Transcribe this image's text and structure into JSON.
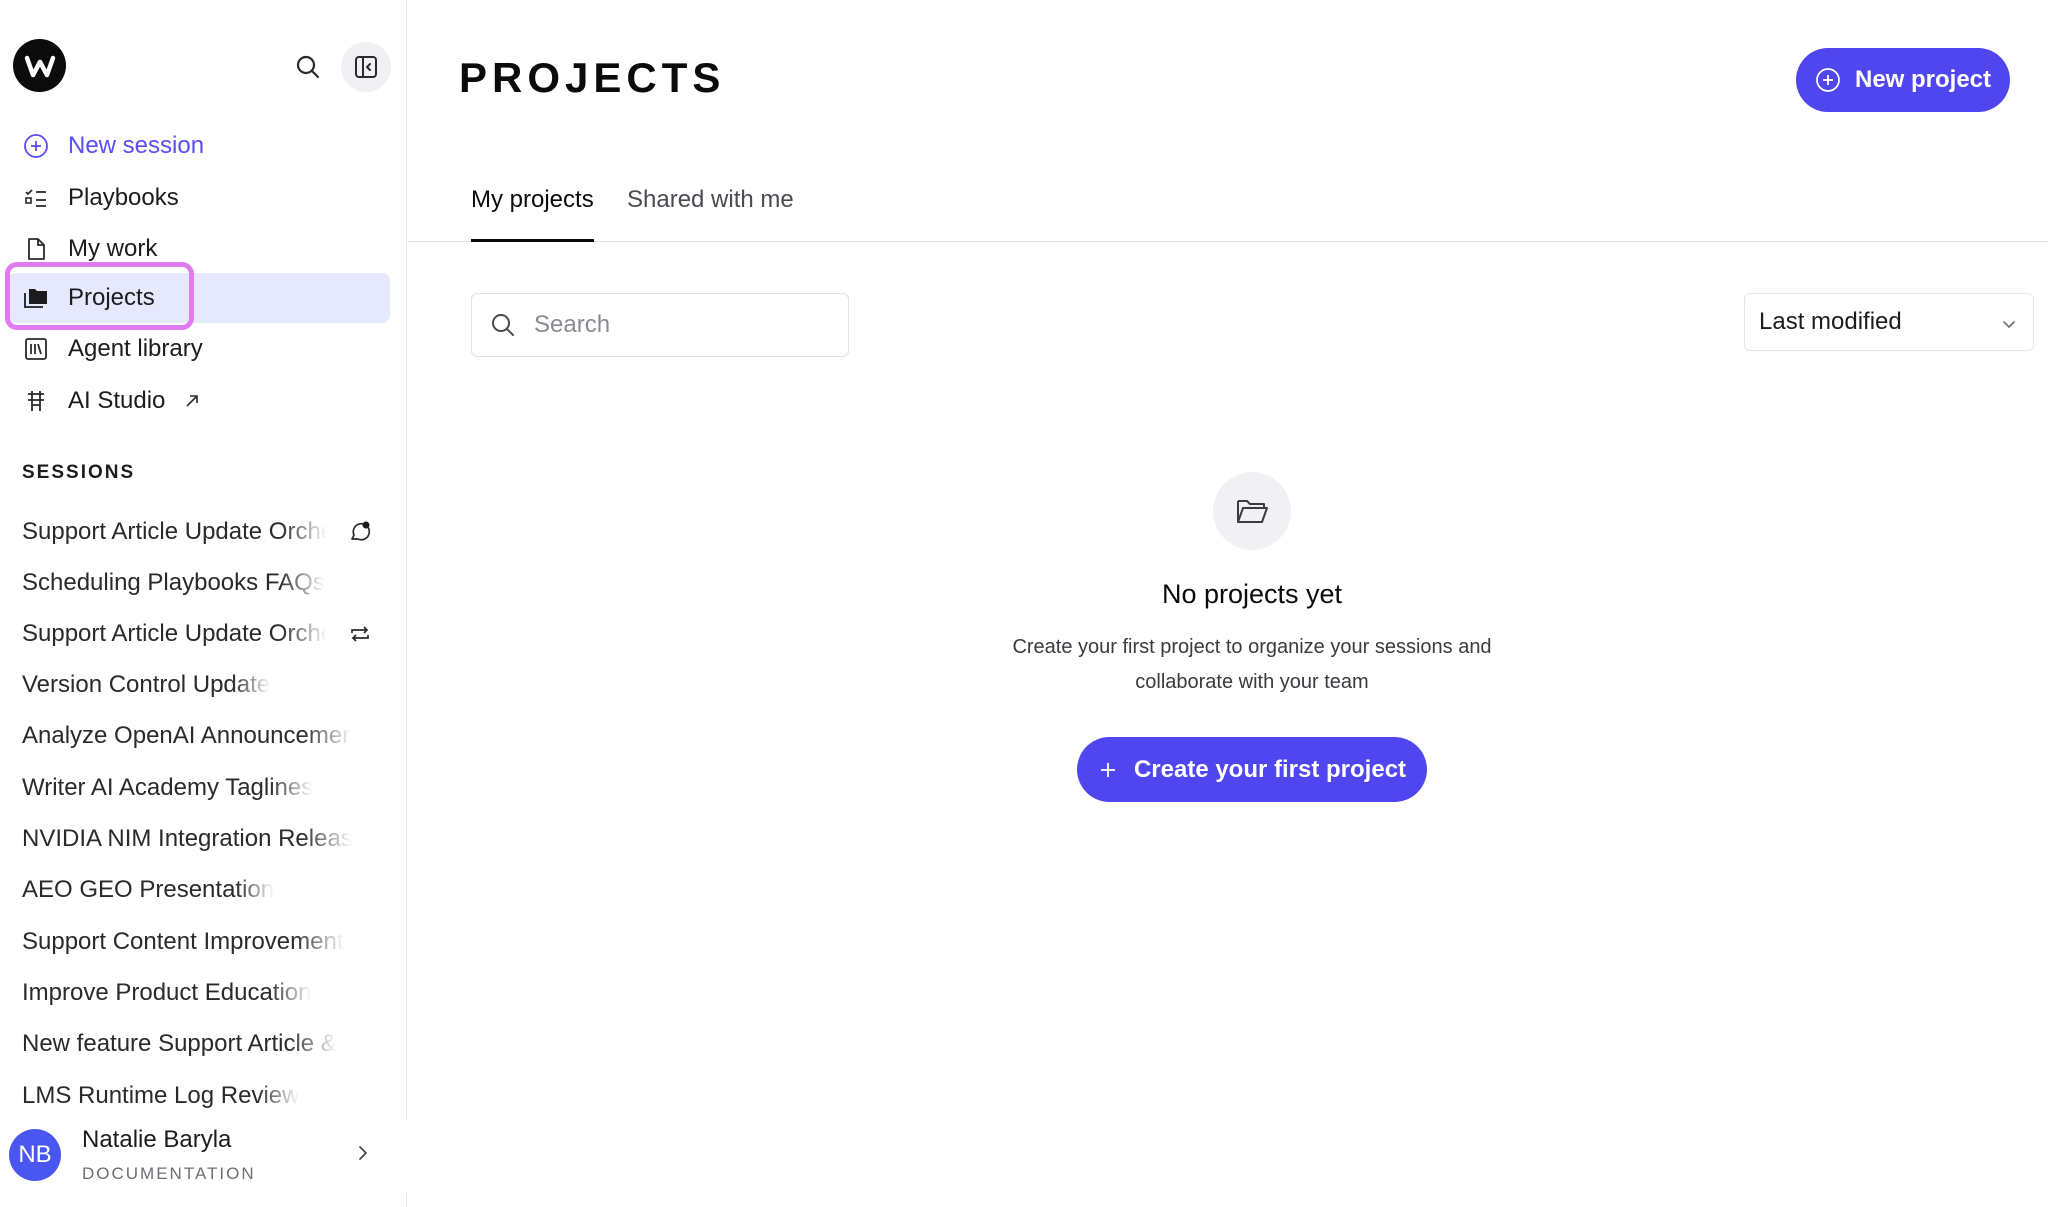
{
  "sidebar": {
    "logo_letter": "W",
    "nav": [
      {
        "label": "New session",
        "icon": "plus-circle-icon"
      },
      {
        "label": "Playbooks",
        "icon": "checklist-icon"
      },
      {
        "label": "My work",
        "icon": "document-icon"
      },
      {
        "label": "Projects",
        "icon": "folders-icon",
        "active": true
      },
      {
        "label": "Agent library",
        "icon": "library-icon"
      },
      {
        "label": "AI Studio",
        "icon": "studio-icon",
        "external": true
      }
    ],
    "sessions_heading": "SESSIONS",
    "sessions": [
      {
        "title": "Support Article Update Orchestration"
      },
      {
        "title": "Scheduling Playbooks FAQs"
      },
      {
        "title": "Support Article Update Orchestration"
      },
      {
        "title": "Version Control Update"
      },
      {
        "title": "Analyze OpenAI Announcement"
      },
      {
        "title": "Writer AI Academy Taglines"
      },
      {
        "title": "NVIDIA NIM Integration Release"
      },
      {
        "title": "AEO GEO Presentation"
      },
      {
        "title": "Support Content Improvement"
      },
      {
        "title": "Improve Product Education"
      },
      {
        "title": "New feature Support Article & "
      },
      {
        "title": "LMS Runtime Log Review"
      }
    ],
    "user": {
      "initials": "NB",
      "name": "Natalie Baryla",
      "org": "DOCUMENTATION"
    }
  },
  "main": {
    "title": "PROJECTS",
    "new_project_label": "New project",
    "tabs": [
      {
        "label": "My projects",
        "active": true
      },
      {
        "label": "Shared with me",
        "active": false
      }
    ],
    "search": {
      "placeholder": "Search",
      "value": ""
    },
    "sort": {
      "selected": "Last modified"
    },
    "empty_state": {
      "title": "No projects yet",
      "description_line1": "Create your first project to organize your sessions and",
      "description_line2": "collaborate with your team",
      "cta_label": "Create your first project"
    }
  },
  "colors": {
    "accent": "#4f46ef",
    "active_nav_bg": "#e6e8fd",
    "highlight_ring": "#e17cf0",
    "avatar": "#4a56f0"
  }
}
